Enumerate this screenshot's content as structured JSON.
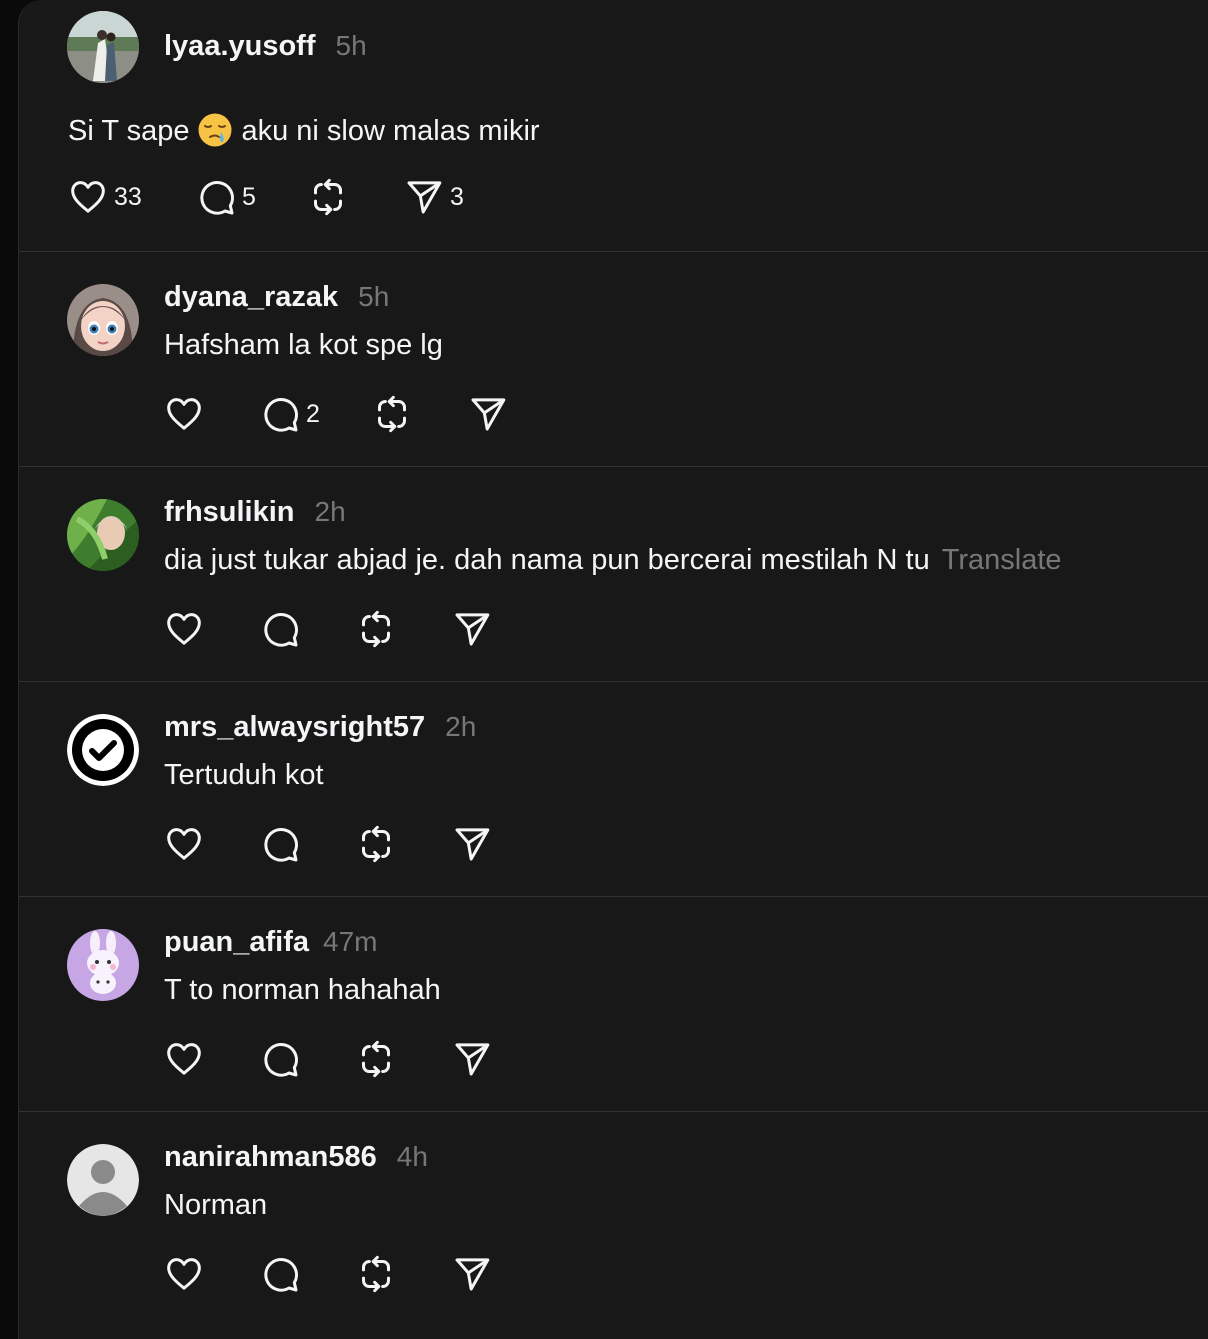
{
  "main_post": {
    "username": "lyaa.yusoff",
    "time": "5h",
    "text_before_emoji": "Si T sape",
    "emoji": "sleepy-face-emoji",
    "text_after_emoji": "aku ni slow malas mikir",
    "likes": "33",
    "replies": "5",
    "shares": "3"
  },
  "replies": [
    {
      "username": "dyana_razak",
      "time": "5h",
      "text": "Hafsham la kot spe lg",
      "reply_count": "2"
    },
    {
      "username": "frhsulikin",
      "time": "2h",
      "text": "dia just tukar abjad je. dah nama pun bercerai mestilah N tu",
      "translate": "Translate"
    },
    {
      "username": "mrs_alwaysright57",
      "time": "2h",
      "text": "Tertuduh kot"
    },
    {
      "username": "puan_afifa",
      "time": "47m",
      "text": "T to norman hahahah"
    },
    {
      "username": "nanirahman586",
      "time": "4h",
      "text": "Norman"
    }
  ],
  "icons": {
    "like": "heart-icon",
    "reply": "comment-bubble-icon",
    "repost": "repost-icon",
    "share": "send-icon"
  },
  "colors": {
    "background": "#181818",
    "text": "#f3f5f7",
    "muted": "#777777",
    "divider": "#323232"
  }
}
